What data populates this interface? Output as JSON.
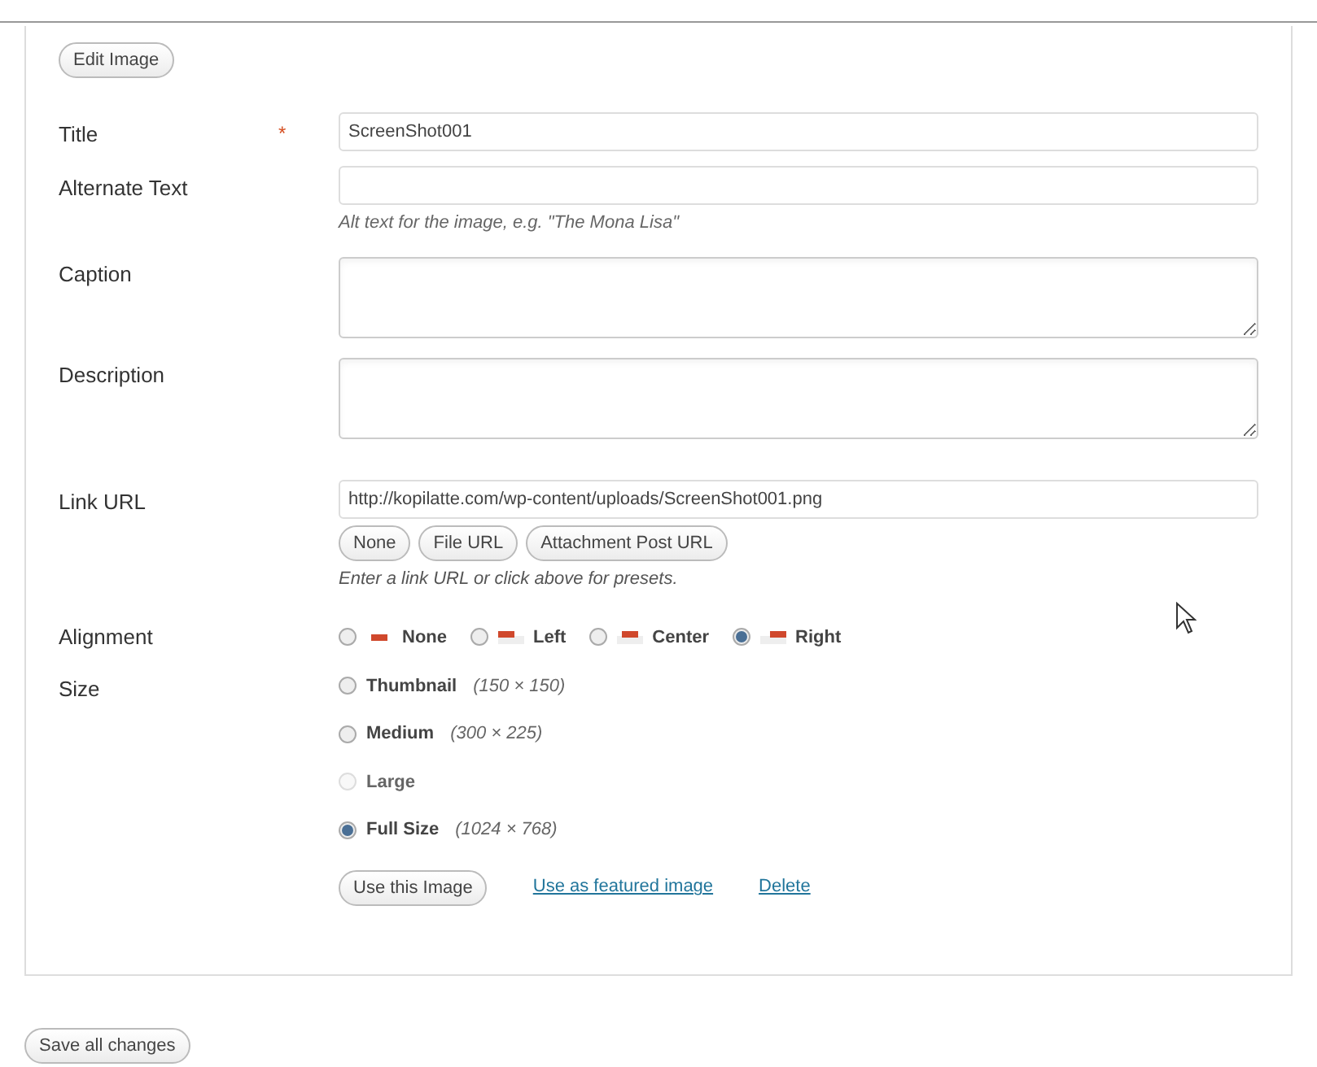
{
  "edit_button": "Edit Image",
  "fields": [
    {
      "kind": "input",
      "label": "Title",
      "required_marker": "*",
      "value": "ScreenShot001"
    },
    {
      "kind": "input",
      "label": "Alternate Text",
      "help": "Alt text for the image, e.g. \"The Mona Lisa\""
    },
    {
      "kind": "textarea",
      "label": "Caption"
    },
    {
      "kind": "textarea",
      "label": "Description"
    }
  ],
  "link_url": {
    "label": "Link URL",
    "value": "http://kopilatte.com/wp-content/uploads/ScreenShot001.png",
    "buttons": [
      "None",
      "File URL",
      "Attachment Post URL"
    ],
    "help": "Enter a link URL or click above for presets."
  },
  "alignment": {
    "label": "Alignment",
    "options": [
      {
        "label": "None",
        "kind": "none",
        "selected": false
      },
      {
        "label": "Left",
        "kind": "left",
        "selected": false
      },
      {
        "label": "Center",
        "kind": "center",
        "selected": false
      },
      {
        "label": "Right",
        "kind": "right",
        "selected": true
      }
    ]
  },
  "size": {
    "label": "Size",
    "options": [
      {
        "label": "Thumbnail",
        "dims": "(150 × 150)",
        "disabled": false,
        "selected": false
      },
      {
        "label": "Medium",
        "dims": "(300 × 225)",
        "disabled": false,
        "selected": false
      },
      {
        "label": "Large",
        "disabled": true,
        "selected": false
      },
      {
        "label": "Full Size",
        "dims": "(1024 × 768)",
        "disabled": false,
        "selected": true
      }
    ]
  },
  "actions": {
    "use_button": "Use this Image",
    "featured_link": "Use as featured image",
    "delete_link": "Delete"
  },
  "save_button": "Save all changes"
}
